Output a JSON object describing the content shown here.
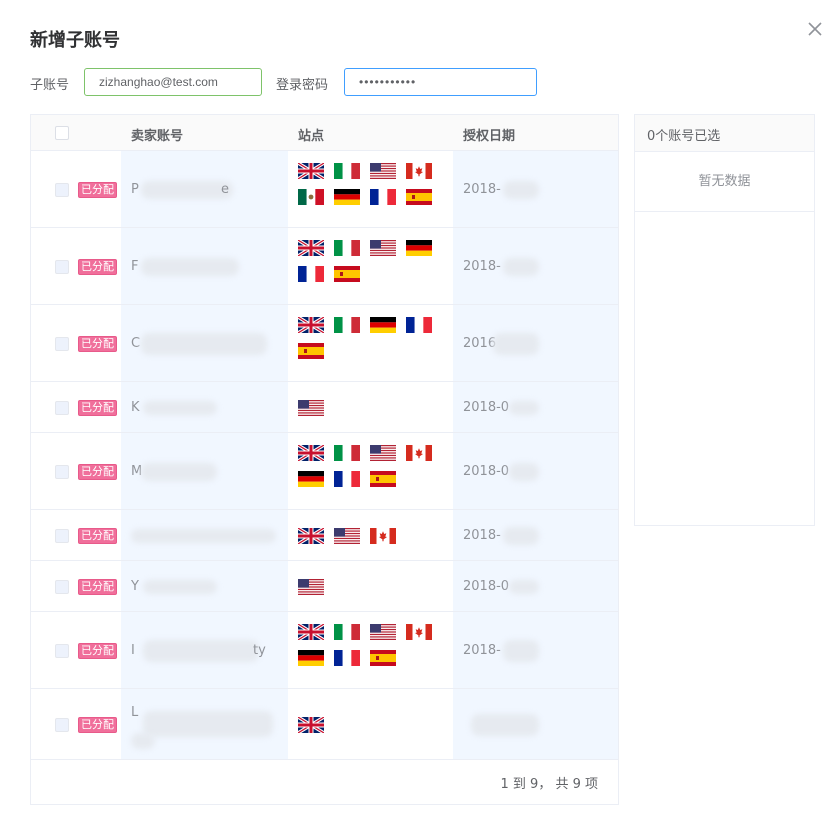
{
  "dialog": {
    "title": "新增子账号"
  },
  "form": {
    "sub_account_label": "子账号",
    "sub_account_value": "zizhanghao@test.com",
    "password_label": "登录密码",
    "password_value": "•••••••••••"
  },
  "table": {
    "headers": {
      "account": "卖家账号",
      "site": "站点",
      "auth_date": "授权日期"
    },
    "assigned_tag": "已分配",
    "rows": [
      {
        "account": "P",
        "account_tail": "e",
        "flags": [
          "uk",
          "it",
          "us",
          "ca",
          "mx",
          "de",
          "fr",
          "es"
        ],
        "date": "2018-"
      },
      {
        "account": "F",
        "account_tail": "",
        "flags": [
          "uk",
          "it",
          "us",
          "de",
          "fr",
          "es"
        ],
        "date": "2018-"
      },
      {
        "account": "C",
        "account_tail": "",
        "flags": [
          "uk",
          "it",
          "de",
          "fr",
          "es"
        ],
        "date": "2016"
      },
      {
        "account": "K",
        "account_tail": "",
        "flags": [
          "us"
        ],
        "date": "2018-0"
      },
      {
        "account": "M",
        "account_tail": "",
        "flags": [
          "uk",
          "it",
          "us",
          "ca",
          "de",
          "fr",
          "es"
        ],
        "date": "2018-0"
      },
      {
        "account": "",
        "account_tail": "",
        "flags": [
          "uk",
          "us",
          "ca"
        ],
        "date": "2018-"
      },
      {
        "account": "Y",
        "account_tail": "",
        "flags": [
          "us"
        ],
        "date": "2018-0"
      },
      {
        "account": "I",
        "account_tail": "ty",
        "flags": [
          "uk",
          "it",
          "us",
          "ca",
          "de",
          "fr",
          "es"
        ],
        "date": "2018-"
      },
      {
        "account": "L",
        "account_tail": "",
        "flags": [
          "uk"
        ],
        "date": ""
      }
    ]
  },
  "pagination": {
    "summary": "1 到 9， 共 9 项"
  },
  "selected_panel": {
    "count_label": "0个账号已选",
    "empty_text": "暂无数据"
  }
}
